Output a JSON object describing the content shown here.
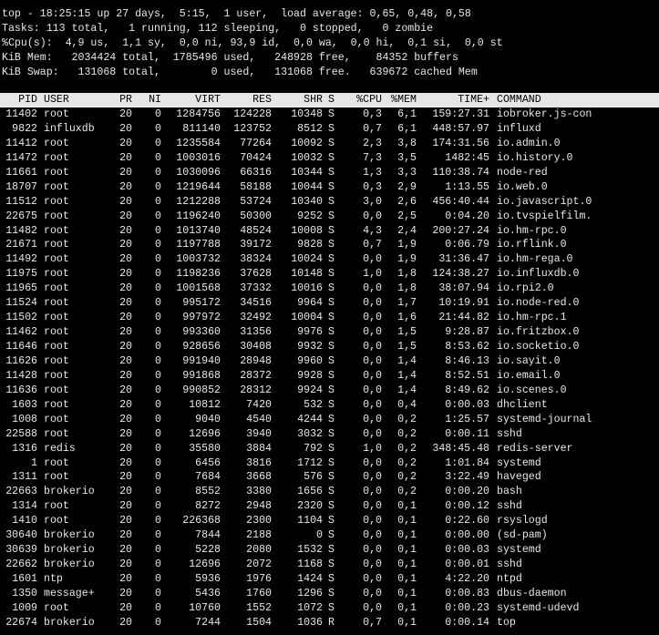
{
  "summary": {
    "line1": "top - 18:25:15 up 27 days,  5:15,  1 user,  load average: 0,65, 0,48, 0,58",
    "line2": "Tasks: 113 total,   1 running, 112 sleeping,   0 stopped,   0 zombie",
    "line3": "%Cpu(s):  4,9 us,  1,1 sy,  0,0 ni, 93,9 id,  0,0 wa,  0,0 hi,  0,1 si,  0,0 st",
    "line4": "KiB Mem:   2034424 total,  1785496 used,   248928 free,    84352 buffers",
    "line5": "KiB Swap:   131068 total,        0 used,   131068 free.   639672 cached Mem"
  },
  "columns": {
    "pid": "PID",
    "user": "USER",
    "pr": "PR",
    "ni": "NI",
    "virt": "VIRT",
    "res": "RES",
    "shr": "SHR",
    "s": "S",
    "cpu": "%CPU",
    "mem": "%MEM",
    "time": "TIME+",
    "command": "COMMAND"
  },
  "processes": [
    {
      "pid": "11402",
      "user": "root",
      "pr": "20",
      "ni": "0",
      "virt": "1284756",
      "res": "124228",
      "shr": "10348",
      "s": "S",
      "cpu": "0,3",
      "mem": "6,1",
      "time": "159:27.31",
      "command": "iobroker.js-con"
    },
    {
      "pid": "9822",
      "user": "influxdb",
      "pr": "20",
      "ni": "0",
      "virt": "811140",
      "res": "123752",
      "shr": "8512",
      "s": "S",
      "cpu": "0,7",
      "mem": "6,1",
      "time": "448:57.97",
      "command": "influxd"
    },
    {
      "pid": "11412",
      "user": "root",
      "pr": "20",
      "ni": "0",
      "virt": "1235584",
      "res": "77264",
      "shr": "10092",
      "s": "S",
      "cpu": "2,3",
      "mem": "3,8",
      "time": "174:31.56",
      "command": "io.admin.0"
    },
    {
      "pid": "11472",
      "user": "root",
      "pr": "20",
      "ni": "0",
      "virt": "1003016",
      "res": "70424",
      "shr": "10032",
      "s": "S",
      "cpu": "7,3",
      "mem": "3,5",
      "time": "1482:45",
      "command": "io.history.0"
    },
    {
      "pid": "11661",
      "user": "root",
      "pr": "20",
      "ni": "0",
      "virt": "1030096",
      "res": "66316",
      "shr": "10344",
      "s": "S",
      "cpu": "1,3",
      "mem": "3,3",
      "time": "110:38.74",
      "command": "node-red"
    },
    {
      "pid": "18707",
      "user": "root",
      "pr": "20",
      "ni": "0",
      "virt": "1219644",
      "res": "58188",
      "shr": "10044",
      "s": "S",
      "cpu": "0,3",
      "mem": "2,9",
      "time": "1:13.55",
      "command": "io.web.0"
    },
    {
      "pid": "11512",
      "user": "root",
      "pr": "20",
      "ni": "0",
      "virt": "1212288",
      "res": "53724",
      "shr": "10340",
      "s": "S",
      "cpu": "3,0",
      "mem": "2,6",
      "time": "456:40.44",
      "command": "io.javascript.0"
    },
    {
      "pid": "22675",
      "user": "root",
      "pr": "20",
      "ni": "0",
      "virt": "1196240",
      "res": "50300",
      "shr": "9252",
      "s": "S",
      "cpu": "0,0",
      "mem": "2,5",
      "time": "0:04.20",
      "command": "io.tvspielfilm."
    },
    {
      "pid": "11482",
      "user": "root",
      "pr": "20",
      "ni": "0",
      "virt": "1013740",
      "res": "48524",
      "shr": "10008",
      "s": "S",
      "cpu": "4,3",
      "mem": "2,4",
      "time": "200:27.24",
      "command": "io.hm-rpc.0"
    },
    {
      "pid": "21671",
      "user": "root",
      "pr": "20",
      "ni": "0",
      "virt": "1197788",
      "res": "39172",
      "shr": "9828",
      "s": "S",
      "cpu": "0,7",
      "mem": "1,9",
      "time": "0:06.79",
      "command": "io.rflink.0"
    },
    {
      "pid": "11492",
      "user": "root",
      "pr": "20",
      "ni": "0",
      "virt": "1003732",
      "res": "38324",
      "shr": "10024",
      "s": "S",
      "cpu": "0,0",
      "mem": "1,9",
      "time": "31:36.47",
      "command": "io.hm-rega.0"
    },
    {
      "pid": "11975",
      "user": "root",
      "pr": "20",
      "ni": "0",
      "virt": "1198236",
      "res": "37628",
      "shr": "10148",
      "s": "S",
      "cpu": "1,0",
      "mem": "1,8",
      "time": "124:38.27",
      "command": "io.influxdb.0"
    },
    {
      "pid": "11965",
      "user": "root",
      "pr": "20",
      "ni": "0",
      "virt": "1001568",
      "res": "37332",
      "shr": "10016",
      "s": "S",
      "cpu": "0,0",
      "mem": "1,8",
      "time": "38:07.94",
      "command": "io.rpi2.0"
    },
    {
      "pid": "11524",
      "user": "root",
      "pr": "20",
      "ni": "0",
      "virt": "995172",
      "res": "34516",
      "shr": "9964",
      "s": "S",
      "cpu": "0,0",
      "mem": "1,7",
      "time": "10:19.91",
      "command": "io.node-red.0"
    },
    {
      "pid": "11502",
      "user": "root",
      "pr": "20",
      "ni": "0",
      "virt": "997972",
      "res": "32492",
      "shr": "10004",
      "s": "S",
      "cpu": "0,0",
      "mem": "1,6",
      "time": "21:44.82",
      "command": "io.hm-rpc.1"
    },
    {
      "pid": "11462",
      "user": "root",
      "pr": "20",
      "ni": "0",
      "virt": "993360",
      "res": "31356",
      "shr": "9976",
      "s": "S",
      "cpu": "0,0",
      "mem": "1,5",
      "time": "9:28.87",
      "command": "io.fritzbox.0"
    },
    {
      "pid": "11646",
      "user": "root",
      "pr": "20",
      "ni": "0",
      "virt": "928656",
      "res": "30408",
      "shr": "9932",
      "s": "S",
      "cpu": "0,0",
      "mem": "1,5",
      "time": "8:53.62",
      "command": "io.socketio.0"
    },
    {
      "pid": "11626",
      "user": "root",
      "pr": "20",
      "ni": "0",
      "virt": "991940",
      "res": "28948",
      "shr": "9960",
      "s": "S",
      "cpu": "0,0",
      "mem": "1,4",
      "time": "8:46.13",
      "command": "io.sayit.0"
    },
    {
      "pid": "11428",
      "user": "root",
      "pr": "20",
      "ni": "0",
      "virt": "991868",
      "res": "28372",
      "shr": "9928",
      "s": "S",
      "cpu": "0,0",
      "mem": "1,4",
      "time": "8:52.51",
      "command": "io.email.0"
    },
    {
      "pid": "11636",
      "user": "root",
      "pr": "20",
      "ni": "0",
      "virt": "990852",
      "res": "28312",
      "shr": "9924",
      "s": "S",
      "cpu": "0,0",
      "mem": "1,4",
      "time": "8:49.62",
      "command": "io.scenes.0"
    },
    {
      "pid": "1603",
      "user": "root",
      "pr": "20",
      "ni": "0",
      "virt": "10812",
      "res": "7420",
      "shr": "532",
      "s": "S",
      "cpu": "0,0",
      "mem": "0,4",
      "time": "0:00.03",
      "command": "dhclient"
    },
    {
      "pid": "1008",
      "user": "root",
      "pr": "20",
      "ni": "0",
      "virt": "9040",
      "res": "4540",
      "shr": "4244",
      "s": "S",
      "cpu": "0,0",
      "mem": "0,2",
      "time": "1:25.57",
      "command": "systemd-journal"
    },
    {
      "pid": "22588",
      "user": "root",
      "pr": "20",
      "ni": "0",
      "virt": "12696",
      "res": "3940",
      "shr": "3032",
      "s": "S",
      "cpu": "0,0",
      "mem": "0,2",
      "time": "0:00.11",
      "command": "sshd"
    },
    {
      "pid": "1316",
      "user": "redis",
      "pr": "20",
      "ni": "0",
      "virt": "35580",
      "res": "3884",
      "shr": "792",
      "s": "S",
      "cpu": "1,0",
      "mem": "0,2",
      "time": "348:45.48",
      "command": "redis-server"
    },
    {
      "pid": "1",
      "user": "root",
      "pr": "20",
      "ni": "0",
      "virt": "6456",
      "res": "3816",
      "shr": "1712",
      "s": "S",
      "cpu": "0,0",
      "mem": "0,2",
      "time": "1:01.84",
      "command": "systemd"
    },
    {
      "pid": "1311",
      "user": "root",
      "pr": "20",
      "ni": "0",
      "virt": "7684",
      "res": "3668",
      "shr": "576",
      "s": "S",
      "cpu": "0,0",
      "mem": "0,2",
      "time": "3:22.49",
      "command": "haveged"
    },
    {
      "pid": "22663",
      "user": "brokerio",
      "pr": "20",
      "ni": "0",
      "virt": "8552",
      "res": "3380",
      "shr": "1656",
      "s": "S",
      "cpu": "0,0",
      "mem": "0,2",
      "time": "0:00.20",
      "command": "bash"
    },
    {
      "pid": "1314",
      "user": "root",
      "pr": "20",
      "ni": "0",
      "virt": "8272",
      "res": "2948",
      "shr": "2320",
      "s": "S",
      "cpu": "0,0",
      "mem": "0,1",
      "time": "0:00.12",
      "command": "sshd"
    },
    {
      "pid": "1410",
      "user": "root",
      "pr": "20",
      "ni": "0",
      "virt": "226368",
      "res": "2300",
      "shr": "1104",
      "s": "S",
      "cpu": "0,0",
      "mem": "0,1",
      "time": "0:22.60",
      "command": "rsyslogd"
    },
    {
      "pid": "30640",
      "user": "brokerio",
      "pr": "20",
      "ni": "0",
      "virt": "7844",
      "res": "2188",
      "shr": "0",
      "s": "S",
      "cpu": "0,0",
      "mem": "0,1",
      "time": "0:00.00",
      "command": "(sd-pam)"
    },
    {
      "pid": "30639",
      "user": "brokerio",
      "pr": "20",
      "ni": "0",
      "virt": "5228",
      "res": "2080",
      "shr": "1532",
      "s": "S",
      "cpu": "0,0",
      "mem": "0,1",
      "time": "0:00.03",
      "command": "systemd"
    },
    {
      "pid": "22662",
      "user": "brokerio",
      "pr": "20",
      "ni": "0",
      "virt": "12696",
      "res": "2072",
      "shr": "1168",
      "s": "S",
      "cpu": "0,0",
      "mem": "0,1",
      "time": "0:00.01",
      "command": "sshd"
    },
    {
      "pid": "1601",
      "user": "ntp",
      "pr": "20",
      "ni": "0",
      "virt": "5936",
      "res": "1976",
      "shr": "1424",
      "s": "S",
      "cpu": "0,0",
      "mem": "0,1",
      "time": "4:22.20",
      "command": "ntpd"
    },
    {
      "pid": "1350",
      "user": "message+",
      "pr": "20",
      "ni": "0",
      "virt": "5436",
      "res": "1760",
      "shr": "1296",
      "s": "S",
      "cpu": "0,0",
      "mem": "0,1",
      "time": "0:00.83",
      "command": "dbus-daemon"
    },
    {
      "pid": "1009",
      "user": "root",
      "pr": "20",
      "ni": "0",
      "virt": "10760",
      "res": "1552",
      "shr": "1072",
      "s": "S",
      "cpu": "0,0",
      "mem": "0,1",
      "time": "0:00.23",
      "command": "systemd-udevd"
    },
    {
      "pid": "22674",
      "user": "brokerio",
      "pr": "20",
      "ni": "0",
      "virt": "7244",
      "res": "1504",
      "shr": "1036",
      "s": "R",
      "cpu": "0,7",
      "mem": "0,1",
      "time": "0:00.14",
      "command": "top"
    }
  ]
}
